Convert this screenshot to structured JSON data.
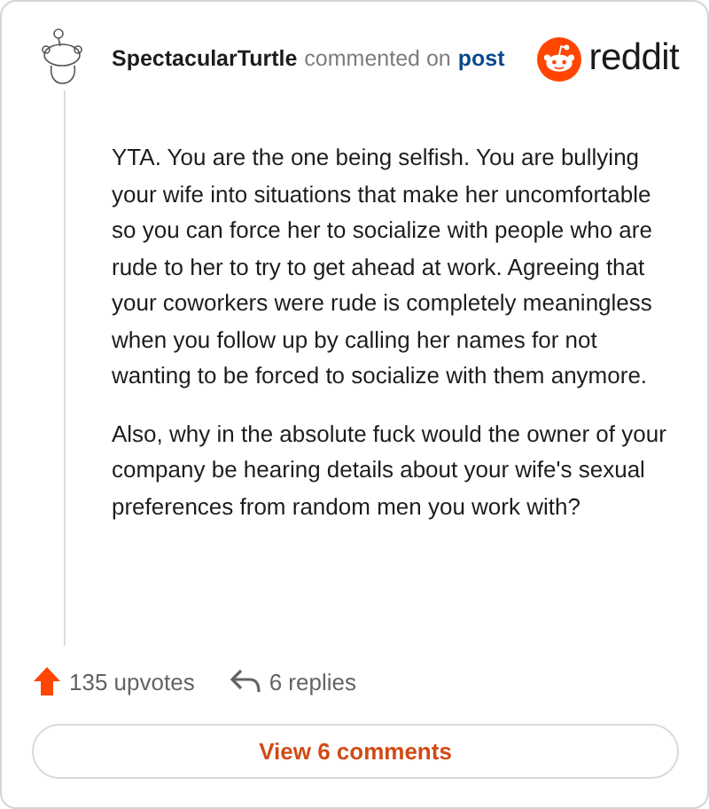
{
  "comment": {
    "author": "SpectacularTurtle",
    "action": "commented on",
    "link": "post",
    "brand": "reddit",
    "paragraphs": [
      "YTA. You are the one being selfish. You are bullying your wife into situations that make her uncomfortable so you can force her to socialize with people who are rude to her to try to get ahead at work. Agreeing that your coworkers were rude is completely meaningless when you follow up by calling her names for not wanting to be forced to socialize with them anymore.",
      "Also, why in the absolute fuck would the owner of your company be hearing details about your wife's sexual preferences from random men you work with?"
    ],
    "upvotes": "135 upvotes",
    "replies": "6 replies",
    "button": "View 6 comments"
  }
}
